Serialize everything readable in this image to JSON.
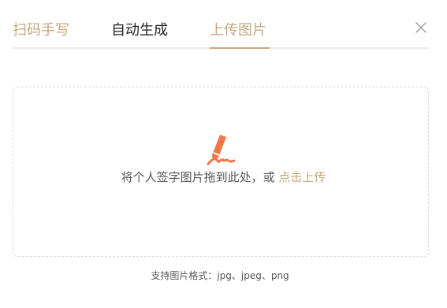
{
  "tabs": [
    {
      "label": "扫码手写"
    },
    {
      "label": "自动生成"
    },
    {
      "label": "上传图片"
    }
  ],
  "active_tab": "上传图片",
  "colors": {
    "accent": "#c6a77d",
    "icon": "#f0764a",
    "text": "#222222",
    "muted": "#555555"
  },
  "upload": {
    "icon": "signature-pen-icon",
    "hint_text": "将个人签字图片拖到此处，或",
    "link_text": "点击上传"
  },
  "formats_text": "支持图片格式：jpg、jpeg、png"
}
